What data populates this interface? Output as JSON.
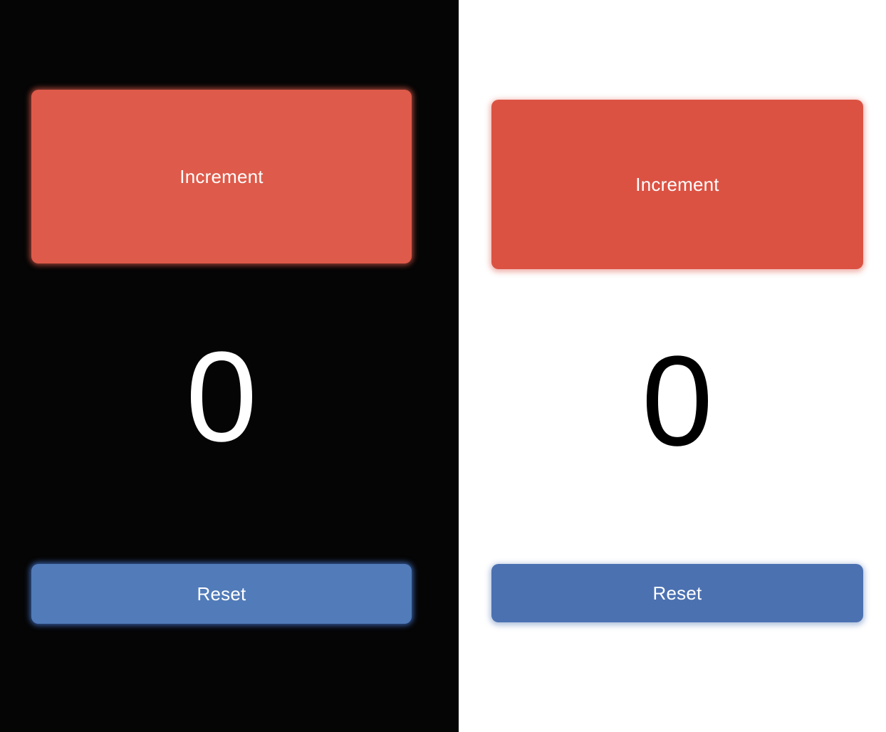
{
  "dark_panel": {
    "increment_label": "Increment",
    "counter_value": "0",
    "reset_label": "Reset",
    "colors": {
      "background": "#050505",
      "increment": "#de5a4a",
      "reset": "#517bb9",
      "counter_text": "#ffffff"
    }
  },
  "light_panel": {
    "increment_label": "Increment",
    "counter_value": "0",
    "reset_label": "Reset",
    "colors": {
      "background": "#ffffff",
      "increment": "#db5243",
      "reset": "#4b71b1",
      "counter_text": "#000000"
    }
  }
}
